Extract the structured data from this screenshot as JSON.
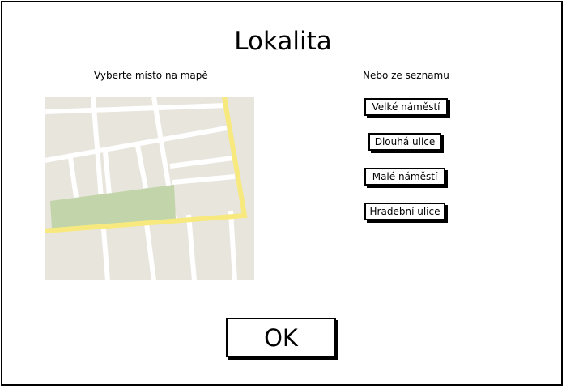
{
  "dialog": {
    "title": "Lokalita"
  },
  "map_section": {
    "caption": "Vyberte místo na mapě"
  },
  "list_section": {
    "caption": "Nebo ze seznamu",
    "locations": [
      {
        "label": "Velké náměstí"
      },
      {
        "label": "Dlouhá ulice"
      },
      {
        "label": "Malé náměstí"
      },
      {
        "label": "Hradební ulice"
      }
    ]
  },
  "actions": {
    "ok_label": "OK"
  },
  "colors": {
    "map_background": "#e8e5dd",
    "map_street": "#ffffff",
    "map_main_road": "#f7e97e",
    "map_park": "#c2d5aa"
  }
}
